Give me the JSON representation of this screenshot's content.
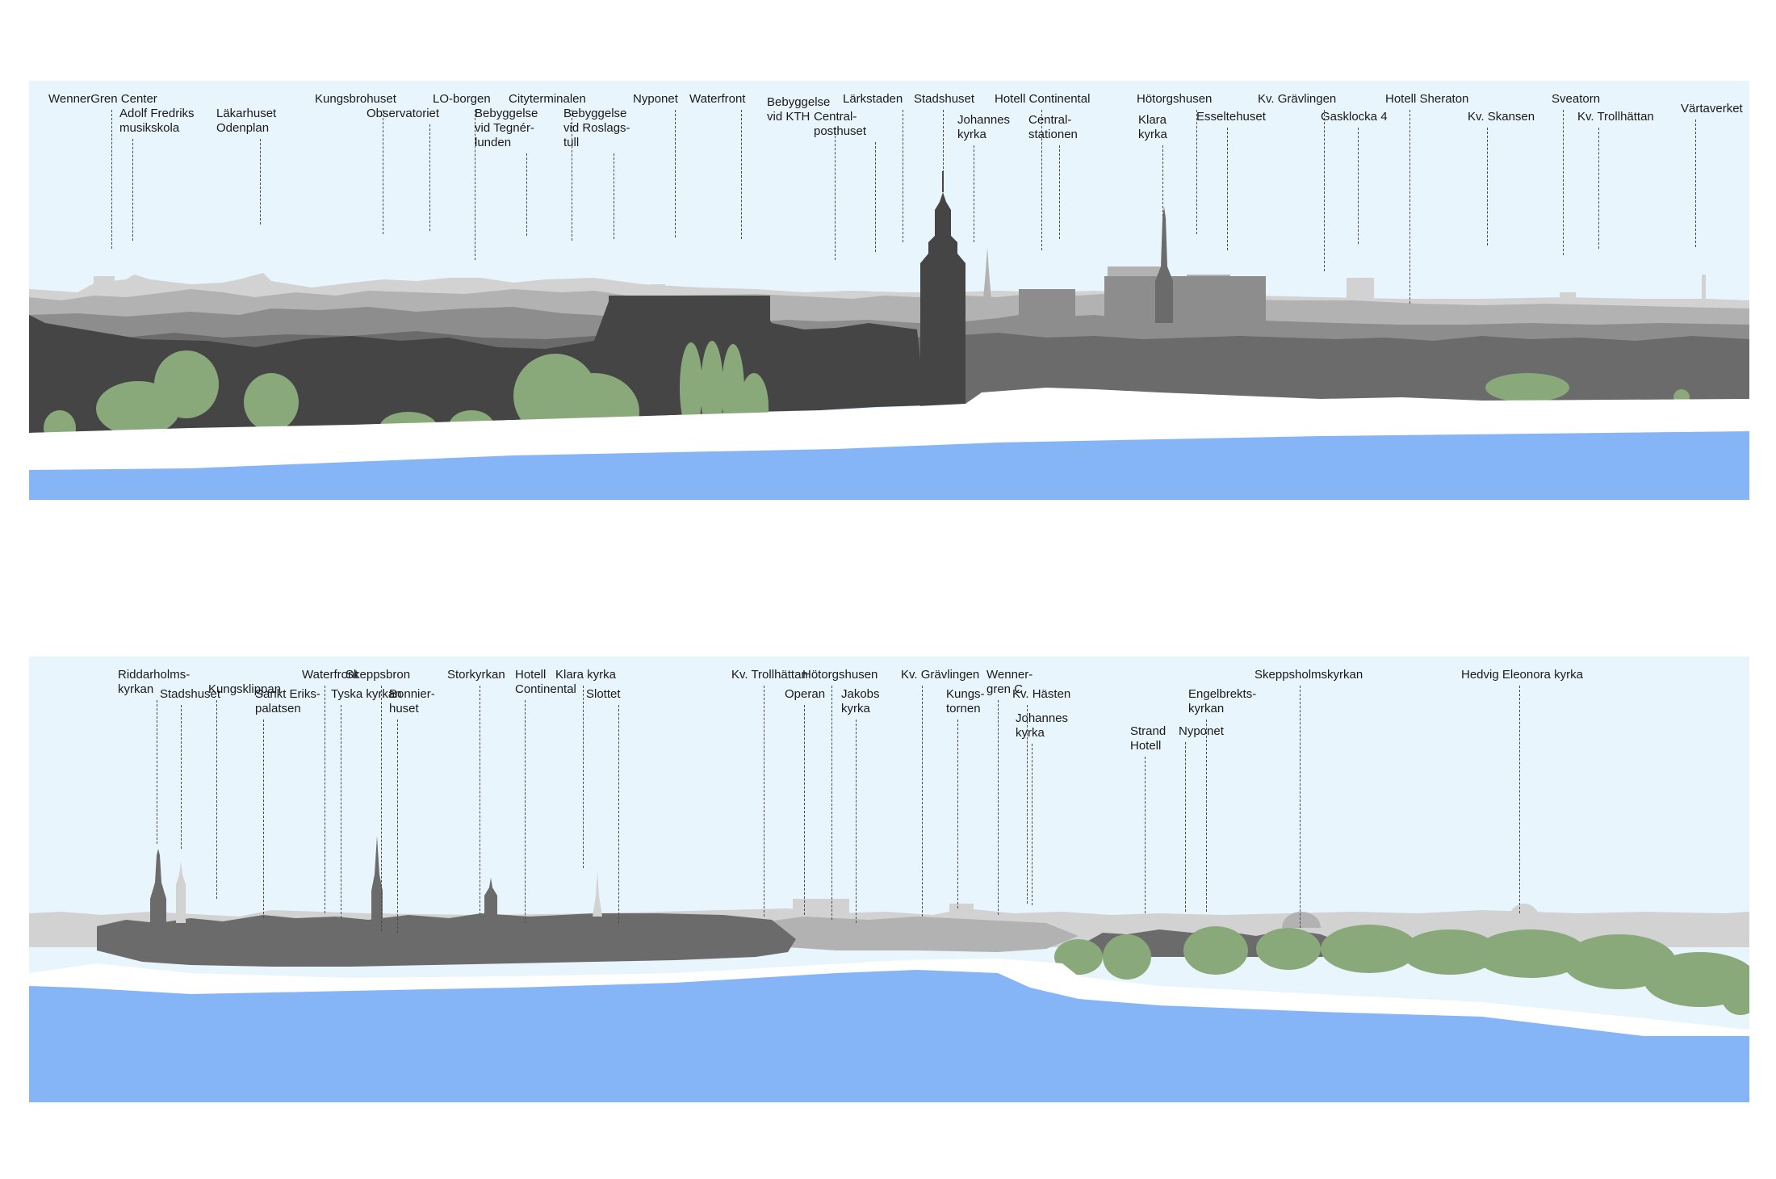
{
  "colors": {
    "sky": "#e8f5fc",
    "water": "#85b5f7",
    "shore": "#ffffff",
    "far": "#d2d2d2",
    "mid_far": "#b2b2b2",
    "mid": "#8d8d8d",
    "near": "#6b6b6b",
    "dark": "#454545",
    "tree": "#8aa97b",
    "leader": "#4a4a4a",
    "text": "#1a1a1a"
  },
  "top_panel": {
    "labels": [
      "WennerGren Center",
      "Adolf Fredriks\nmusikskola",
      "Läkarhuset\nOdenplan",
      "Kungsbrohuset",
      "Observatoriet",
      "LO-borgen",
      "Bebyggelse\nvid Tegnér-\nlunden",
      "Cityterminalen",
      "Bebyggelse\nvid Roslags-\ntull",
      "Nyponet",
      "Waterfront",
      "Bebyggelse\nvid KTH",
      "Central-\nposthuset",
      "Lärkstaden",
      "Stadshuset",
      "Johannes\nkyrka",
      "Hotell Continental",
      "Central-\nstationen",
      "Hötorgshusen",
      "Klara\nkyrka",
      "Esselte­huset",
      "Kv. Grävlingen",
      "Gasklocka 4",
      "Hotell Sheraton",
      "Kv. Skansen",
      "Sveatorn",
      "Kv. Trollhättan",
      "Värtaverket"
    ]
  },
  "bottom_panel": {
    "labels": [
      "Riddarholms-\nkyrkan",
      "Stadshuset",
      "Kungsklippan",
      "Sankt Eriks-\npalatsen",
      "Waterfront",
      "Tyska kyrkan",
      "Skeppsbron",
      "Bonnier-\nhuset",
      "Storkyrkan",
      "Hotell\nContinental",
      "Klara kyrka",
      "Slottet",
      "Kv. Trollhättan",
      "Operan",
      "Hötorgshusen",
      "Jakobs\nkyrka",
      "Kv. Grävlingen",
      "Kungs-\ntornen",
      "Wenner-\ngren C",
      "Kv. Hästen",
      "Johannes\nkyrka",
      "Strand\nHotell",
      "Nyponet",
      "Engelbrekts-\nkyrkan",
      "Skeppsholmskyrkan",
      "Hedvig Eleonora kyrka"
    ]
  }
}
